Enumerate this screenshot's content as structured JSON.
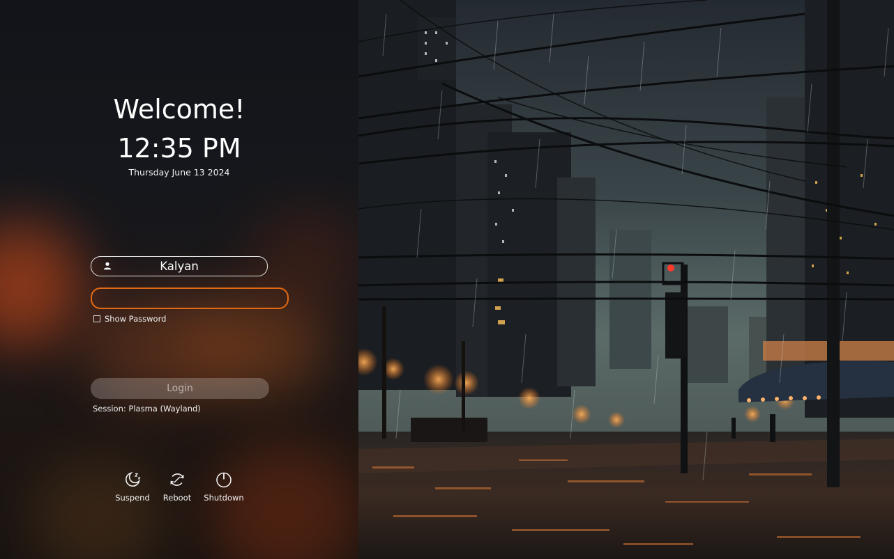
{
  "greeting": "Welcome!",
  "clock": {
    "time": "12:35 PM",
    "date": "Thursday June 13 2024"
  },
  "login": {
    "username": "Kalyan",
    "password_value": "",
    "password_placeholder": "",
    "show_password_label": "Show Password",
    "show_password_checked": false,
    "login_button_label": "Login",
    "session_label": "Session: Plasma (Wayland)"
  },
  "power_actions": [
    {
      "label": "Suspend",
      "icon": "moon-icon"
    },
    {
      "label": "Reboot",
      "icon": "reboot-icon"
    },
    {
      "label": "Shutdown",
      "icon": "power-icon"
    }
  ],
  "colors": {
    "password_focus_border": "#e36a15",
    "text": "#ffffff"
  },
  "wallpaper": {
    "description_icon": "rainy-city-street-wallpaper"
  }
}
